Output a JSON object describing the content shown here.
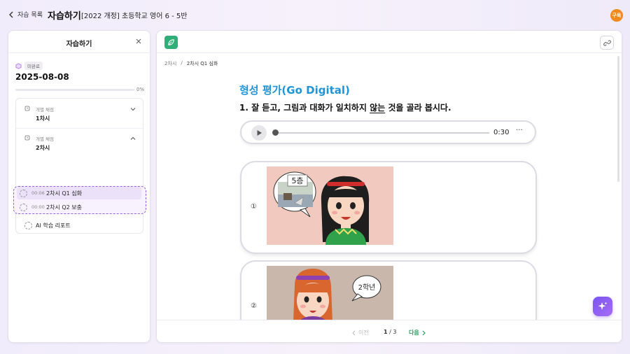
{
  "topbar": {
    "back_label": "자습 목록",
    "title": "자습하기",
    "course": "[2022 개정] 초등학교 영어 6 - 5반",
    "avatar_text": "구육",
    "avatar_color": "#f08a1c"
  },
  "sidebar": {
    "title": "자습하기",
    "status_badge": "미완료",
    "date": "2025-08-08",
    "progress_percent": 0,
    "progress_label": "0%",
    "sections": [
      {
        "type": "개별 채점",
        "name": "1차시",
        "expanded": false
      },
      {
        "type": "개별 채점",
        "name": "2차시",
        "expanded": true
      }
    ],
    "items": [
      {
        "time": "00:06",
        "label": "2차시 Q1 심화",
        "active": true
      },
      {
        "time": "00:00",
        "label": "2차시 Q2 보충",
        "active": false
      }
    ],
    "report_label": "AI 학습 리포트"
  },
  "main": {
    "breadcrumb": [
      "2차시",
      "2차시 Q1 심화"
    ],
    "heading": "형성 평가(Go Digital)",
    "question_prefix": "1. 잘 듣고, 그림과 대화가 일치하지 ",
    "question_underline": "않는",
    "question_suffix": " 것을 골라 봅시다.",
    "audio_time": "0:30",
    "audio_more": "···",
    "options": [
      {
        "number": "①",
        "bubble": "5층"
      },
      {
        "number": "②",
        "bubble": "2학년"
      }
    ]
  },
  "pager": {
    "prev_label": "이전",
    "current": "1",
    "total": "3",
    "separator": " / ",
    "next_label": "다음"
  },
  "colors": {
    "accent_purple": "#9461e8",
    "heading_blue": "#1f95d8",
    "next_green": "#2a9d62"
  },
  "icons": [
    "chevron-left-icon",
    "close-icon",
    "clock-icon",
    "chevron-down-icon",
    "chevron-up-icon",
    "leaf-icon",
    "link-icon",
    "play-icon",
    "sparkle-icon"
  ]
}
